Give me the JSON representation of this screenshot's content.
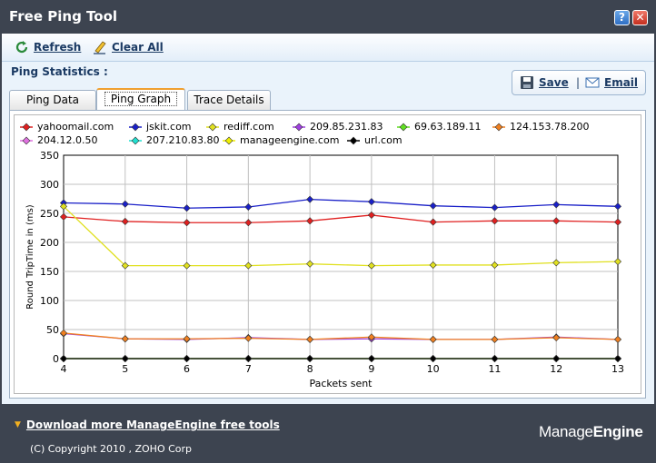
{
  "window": {
    "title": "Free Ping Tool"
  },
  "toolbar": {
    "refresh_label": "Refresh",
    "clear_label": "Clear All"
  },
  "stats_label": "Ping Statistics :",
  "actions": {
    "save_label": "Save",
    "email_label": "Email",
    "separator": "|"
  },
  "tabs": [
    {
      "label": "Ping Data"
    },
    {
      "label": "Ping Graph"
    },
    {
      "label": "Trace Details"
    }
  ],
  "active_tab": "Ping Graph",
  "chart_data": {
    "type": "line",
    "xlabel": "Packets sent",
    "ylabel": "Round TripTime in (ms)",
    "x": [
      4,
      5,
      6,
      7,
      8,
      9,
      10,
      11,
      12,
      13
    ],
    "xlim": [
      4,
      13
    ],
    "ylim": [
      0,
      350
    ],
    "yticks": [
      0,
      50,
      100,
      150,
      200,
      250,
      300,
      350
    ],
    "grid": true,
    "legend_position": "top",
    "series": [
      {
        "name": "yahoomail.com",
        "color": "#e02020",
        "values": [
          244,
          236,
          234,
          234,
          237,
          247,
          235,
          237,
          237,
          235
        ]
      },
      {
        "name": "jskit.com",
        "color": "#1a20c8",
        "values": [
          268,
          266,
          259,
          261,
          274,
          270,
          263,
          260,
          265,
          262
        ]
      },
      {
        "name": "rediff.com",
        "color": "#e0e020",
        "values": [
          262,
          160,
          160,
          160,
          163,
          160,
          161,
          161,
          165,
          167
        ]
      },
      {
        "name": "209.85.231.83",
        "color": "#a040e0",
        "values": [
          43,
          34,
          33,
          36,
          33,
          34,
          33,
          33,
          37,
          33
        ]
      },
      {
        "name": "69.63.189.11",
        "color": "#60e020",
        "values": [
          0,
          0,
          0,
          0,
          0,
          0,
          0,
          0,
          0,
          0
        ]
      },
      {
        "name": "124.153.78.200",
        "color": "#f08020",
        "values": [
          44,
          34,
          34,
          35,
          33,
          37,
          33,
          33,
          36,
          33
        ]
      },
      {
        "name": "204.12.0.50",
        "color": "#e070e0",
        "values": [
          0,
          0,
          0,
          0,
          0,
          0,
          0,
          0,
          0,
          0
        ]
      },
      {
        "name": "207.210.83.80",
        "color": "#20e0d0",
        "values": [
          0,
          0,
          0,
          0,
          0,
          0,
          0,
          0,
          0,
          0
        ]
      },
      {
        "name": "manageengine.com",
        "color": "#f0f000",
        "values": [
          0,
          0,
          0,
          0,
          0,
          0,
          0,
          0,
          0,
          0
        ]
      },
      {
        "name": "url.com",
        "color": "#000000",
        "values": [
          0,
          0,
          0,
          0,
          0,
          0,
          0,
          0,
          0,
          0
        ]
      }
    ]
  },
  "footer": {
    "download_label": "Download more ManageEngine free tools",
    "copyright": "(C) Copyright 2010 , ZOHO Corp",
    "brand_prefix": "Manage",
    "brand_suffix": "Engine"
  },
  "icons": {
    "help": "?",
    "close": "✕",
    "download_arrow": "▼"
  }
}
